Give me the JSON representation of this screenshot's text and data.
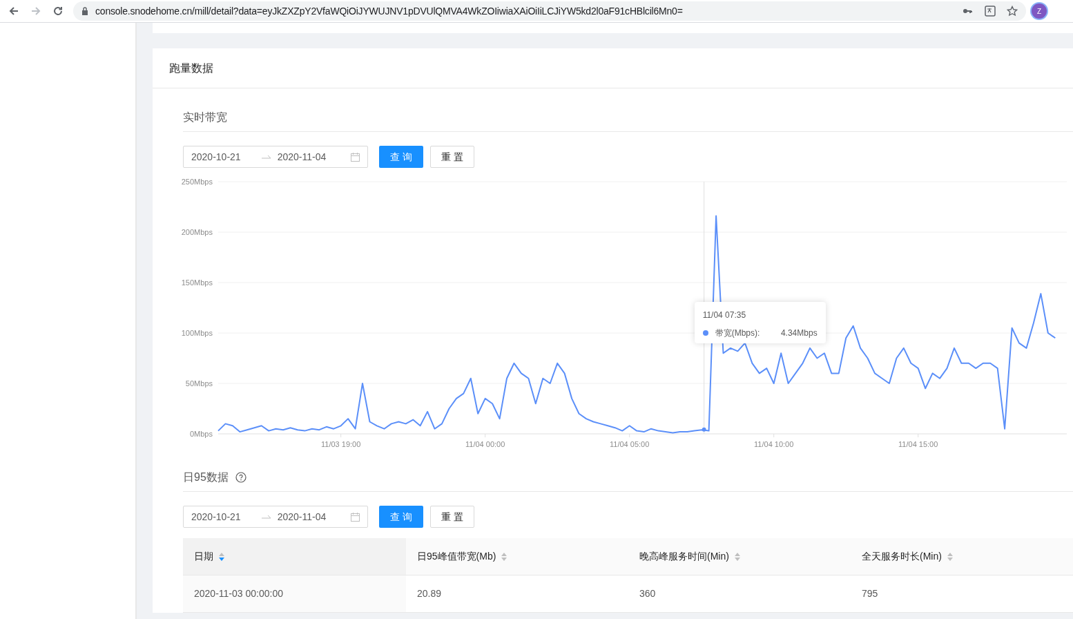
{
  "browser": {
    "url": "console.snodehome.cn/mill/detail?data=eyJkZXZpY2VfaWQiOiJYWUJNV1pDVUlQMVA4WkZOIiwiaXAiOiIiLCJiYW5kd2l0aF91cHBlcil6Mn0=",
    "profile_initial": "Z"
  },
  "card": {
    "title": "跑量数据"
  },
  "realtime": {
    "title": "实时带宽",
    "range": {
      "start": "2020-10-21",
      "end": "2020-11-04"
    },
    "buttons": [
      "查 询",
      "重 置"
    ],
    "chart_data": {
      "type": "line",
      "categories": [
        null,
        null,
        null,
        null,
        null,
        null,
        null,
        null,
        null,
        null,
        null,
        null,
        null,
        null,
        null,
        null,
        null,
        "11/03 19:00",
        null,
        null,
        null,
        null,
        null,
        null,
        null,
        null,
        null,
        null,
        null,
        null,
        null,
        null,
        null,
        null,
        null,
        null,
        null,
        "11/04 00:00",
        null,
        null,
        null,
        null,
        null,
        null,
        null,
        null,
        null,
        null,
        null,
        null,
        null,
        null,
        null,
        null,
        null,
        null,
        null,
        "11/04 05:00",
        null,
        null,
        null,
        null,
        null,
        null,
        null,
        null,
        null,
        null,
        null,
        null,
        null,
        null,
        null,
        null,
        null,
        null,
        null,
        "11/04 10:00",
        null,
        null,
        null,
        null,
        null,
        null,
        null,
        null,
        null,
        null,
        null,
        null,
        null,
        null,
        null,
        null,
        null,
        null,
        null,
        "11/04 15:00",
        null,
        null,
        null,
        null,
        null,
        null,
        null,
        null,
        null,
        null,
        null,
        null,
        null,
        null,
        null,
        null,
        null,
        null,
        null
      ],
      "series": [
        {
          "color": "#5b8ff9",
          "values": [
            3,
            10,
            8,
            2,
            4,
            6,
            8,
            3,
            5,
            4,
            6,
            4,
            3,
            5,
            4,
            7,
            5,
            8,
            15,
            5,
            50,
            12,
            8,
            5,
            10,
            12,
            10,
            14,
            8,
            22,
            5,
            10,
            25,
            35,
            40,
            55,
            20,
            35,
            30,
            15,
            55,
            70,
            60,
            55,
            30,
            55,
            50,
            70,
            60,
            35,
            20,
            15,
            12,
            10,
            8,
            6,
            3,
            8,
            3,
            2,
            5,
            3,
            2,
            1,
            2,
            2,
            3,
            4,
            3,
            216,
            80,
            85,
            82,
            90,
            70,
            60,
            65,
            50,
            80,
            50,
            60,
            70,
            85,
            75,
            80,
            60,
            60,
            95,
            107,
            85,
            75,
            60,
            55,
            50,
            75,
            85,
            70,
            65,
            45,
            60,
            55,
            65,
            85,
            70,
            70,
            65,
            70,
            70,
            65,
            5,
            105,
            90,
            85,
            110,
            139,
            100,
            95
          ]
        }
      ],
      "ylim": [
        0,
        250
      ],
      "grid": true,
      "yticks": [
        {
          "value": 0,
          "label": "0Mbps"
        },
        {
          "value": 50,
          "label": "50Mbps"
        },
        {
          "value": 100,
          "label": "100Mbps"
        },
        {
          "value": 150,
          "label": "150Mbps"
        },
        {
          "value": 200,
          "label": "200Mbps"
        },
        {
          "value": 250,
          "label": "250Mbps"
        }
      ],
      "ylabel": null
    },
    "tooltip": {
      "title": "11/04 07:35",
      "series_label": "带宽(Mbps):",
      "value": "4.34Mbps"
    }
  },
  "daily95": {
    "title": "日95数据",
    "range": {
      "start": "2020-10-21",
      "end": "2020-11-04"
    },
    "buttons": [
      "查 询",
      "重 置"
    ],
    "table": {
      "columns": [
        {
          "label": "日期",
          "sorted": true
        },
        {
          "label": "日95峰值带宽(Mb)",
          "sorted": false
        },
        {
          "label": "晚高峰服务时间(Min)",
          "sorted": false
        },
        {
          "label": "全天服务时长(Min)",
          "sorted": false
        }
      ],
      "rows": [
        [
          "2020-11-03 00:00:00",
          "20.89",
          "360",
          "795"
        ]
      ]
    }
  }
}
